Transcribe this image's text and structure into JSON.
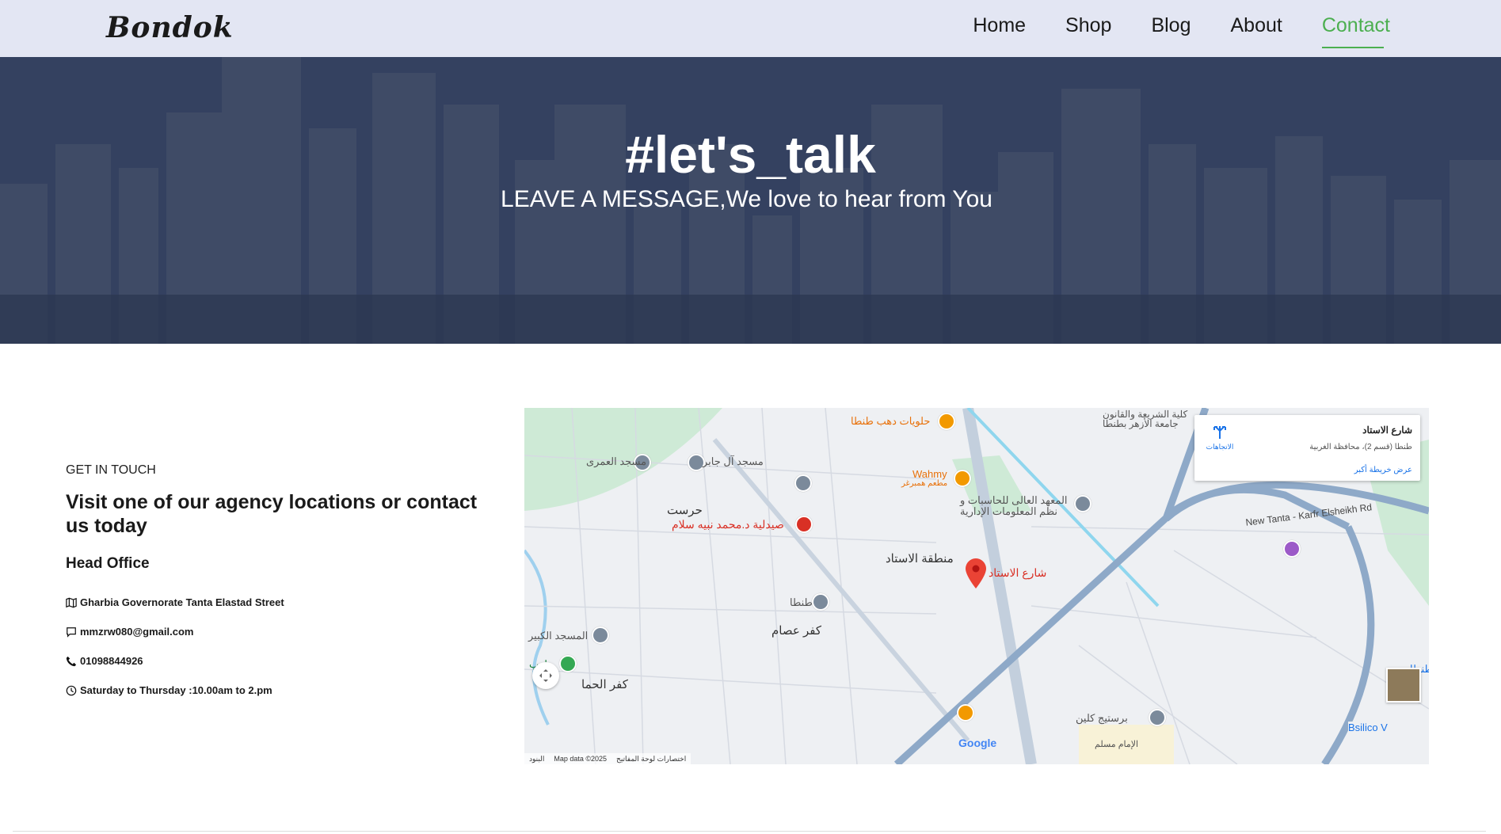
{
  "header": {
    "logo": "Bondok",
    "nav": [
      "Home",
      "Shop",
      "Blog",
      "About",
      "Contact"
    ],
    "active": "Contact"
  },
  "hero": {
    "title": "#let's_talk",
    "subtitle": "LEAVE A MESSAGE,We love to hear from You"
  },
  "contact": {
    "eyebrow": "GET IN TOUCH",
    "heading": "Visit one of our agency locations or contact us today",
    "office": "Head Office",
    "address": "Gharbia Governorate Tanta Elastad Street",
    "email": "mmzrw080@gmail.com",
    "phone": "01098844926",
    "hours": "Saturday to Thursday :10.00am to 2.pm"
  },
  "map": {
    "card_title": "شارع الاستاد",
    "card_subtitle": "طنطا (قسم 2)، محافظة الغربية",
    "card_link": "عرض خريطة أكبر",
    "card_directions": "الاتجاهات",
    "pin_label": "شارع الاستاد",
    "district": "منطقة الاستاد",
    "labels": {
      "sweets": "حلويات دهب طنطا",
      "law": "كلية الشريعة والقانون جامعة الأزهر بطنطا",
      "mosque1": "مسجد آل جابر",
      "mosque2": "مسجد العمرى",
      "wahmy": "Wahmy",
      "wahmy_ar": "مطعم همبرغر",
      "institute": "المعهد العالى للحاسبات و نظم المعلومات الإدارية",
      "harast": "حرست",
      "pharmacy": "صيدلية د.محمد نبيه سلام",
      "tanta": "طنطا",
      "kafr_esam": "كفر عصام",
      "mosque3": "المسجد الكبير",
      "kafr_hama": "كفر الحما",
      "playground": "ملعب",
      "new_tanta": "New Tanta - Karfr Elsheikh Rd",
      "bsilico": "Bsilico V",
      "prestige": "برستيج كلين",
      "imam": "الإمام مسلم",
      "tanta_right": "طنطا",
      "google": "Google",
      "keyboard": "اختصارات لوحة المفاتيح",
      "mapdata": "Map data ©2025",
      "terms": "البنود"
    }
  }
}
